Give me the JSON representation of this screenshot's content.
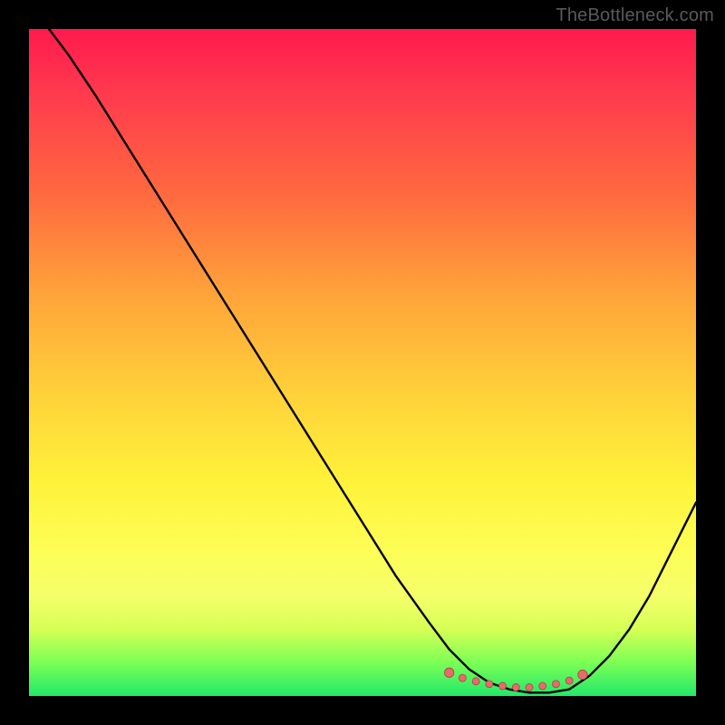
{
  "watermark": "TheBottleneck.com",
  "colors": {
    "background": "#000000",
    "gradient_top": "#ff1a4d",
    "gradient_bottom": "#22e86a",
    "curve": "#000000",
    "marker_fill": "#e86a6a",
    "marker_stroke": "#a84545"
  },
  "chart_data": {
    "type": "line",
    "title": "",
    "xlabel": "",
    "ylabel": "",
    "xlim": [
      0,
      100
    ],
    "ylim": [
      0,
      100
    ],
    "series": [
      {
        "name": "bottleneck-curve",
        "x": [
          3,
          6,
          10,
          15,
          20,
          25,
          30,
          35,
          40,
          45,
          50,
          55,
          60,
          63,
          66,
          69,
          72,
          75,
          78,
          81,
          84,
          87,
          90,
          93,
          96,
          100
        ],
        "y": [
          100,
          96,
          90,
          82,
          74,
          66,
          58,
          50,
          42,
          34,
          26,
          18,
          11,
          7,
          4,
          2,
          1,
          0.5,
          0.5,
          1,
          3,
          6,
          10,
          15,
          21,
          29
        ]
      }
    ],
    "markers": {
      "name": "optimal-range",
      "x": [
        63,
        65,
        67,
        69,
        71,
        73,
        75,
        77,
        79,
        81,
        83
      ],
      "y": [
        3.5,
        2.7,
        2.2,
        1.8,
        1.5,
        1.3,
        1.3,
        1.5,
        1.8,
        2.3,
        3.2
      ]
    }
  }
}
